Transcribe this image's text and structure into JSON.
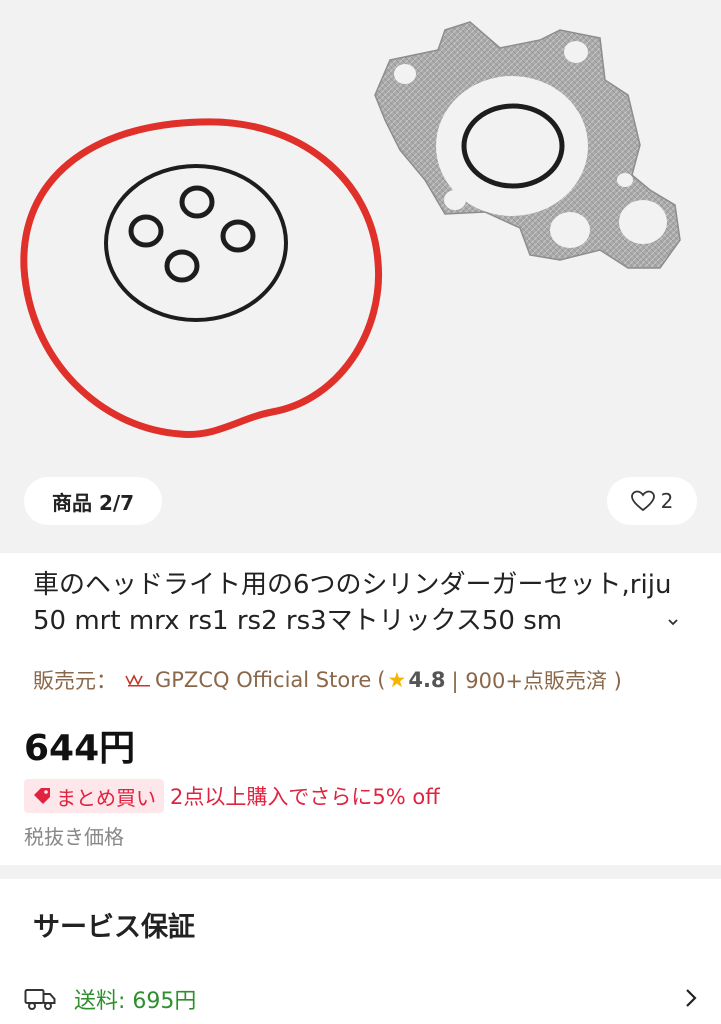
{
  "gallery": {
    "counter_label": "商品 2/7",
    "wishlist_count": "2"
  },
  "product": {
    "title": "車のヘッドライト用の6つのシリンダーガーセット,riju 50 mrt mrx rs1 rs2 rs3マトリックス50 sm",
    "seller_prefix": "販売元：",
    "seller_name": "GPZCQ Official Store",
    "open_paren": "(",
    "rating": "4.8",
    "sold": "| 900+点販売済 )",
    "price": "644円",
    "bulk_badge": "まとめ買い",
    "bulk_text": "2点以上購入でさらに5% off",
    "tax_note": "税抜き価格"
  },
  "service": {
    "title": "サービス保証",
    "shipping": "送料: 695円"
  },
  "colors": {
    "accent_red": "#e0233f",
    "seller_brown": "#8a6748",
    "shipping_green": "#2f8f2f",
    "gasket_red": "#e0302a"
  }
}
